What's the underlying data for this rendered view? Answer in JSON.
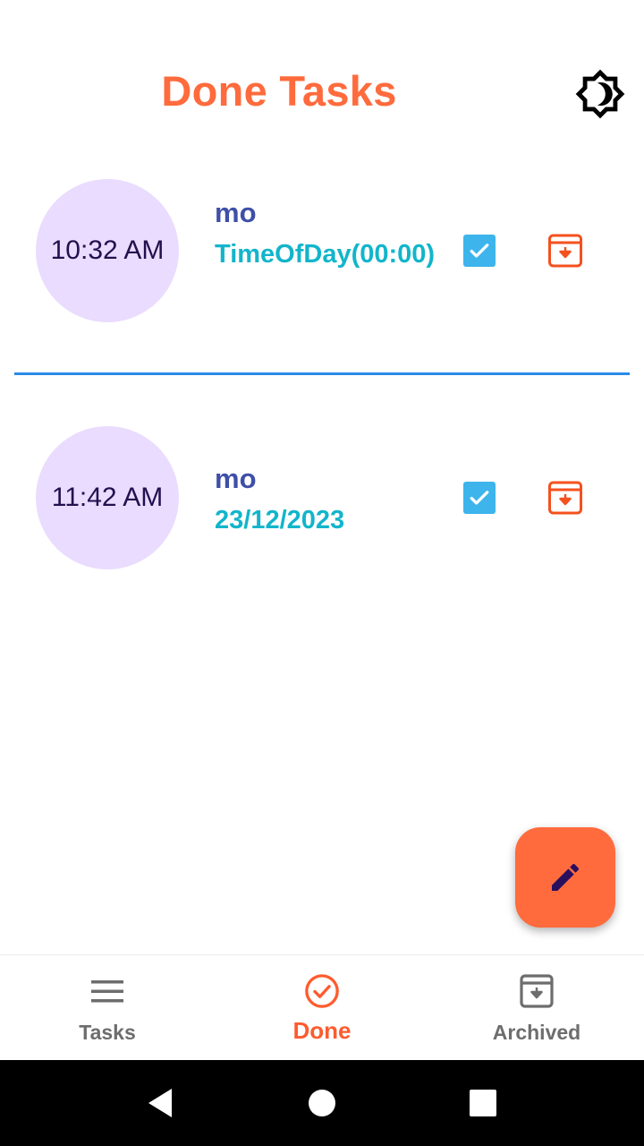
{
  "header": {
    "title": "Done Tasks",
    "theme_icon": "brightness-moon-icon"
  },
  "tasks": [
    {
      "time": "10:32 AM",
      "title": "mo",
      "date": "TimeOfDay(00:00)",
      "done": true
    },
    {
      "time": "11:42 AM",
      "title": "mo",
      "date": "23/12/2023",
      "done": true
    }
  ],
  "fab": {
    "icon": "pencil-icon"
  },
  "bottom_nav": [
    {
      "label": "Tasks",
      "icon": "menu-icon",
      "active": false
    },
    {
      "label": "Done",
      "icon": "check-circle-icon",
      "active": true
    },
    {
      "label": "Archived",
      "icon": "archive-icon",
      "active": false
    }
  ],
  "colors": {
    "accent": "#ff6b3d",
    "title_text": "#3f4fa8",
    "date_text": "#12b5cb",
    "time_circle": "#eadcfe",
    "checkbox": "#3db4ec",
    "divider": "#2a8be6",
    "nav_inactive": "#6d6d6d"
  }
}
